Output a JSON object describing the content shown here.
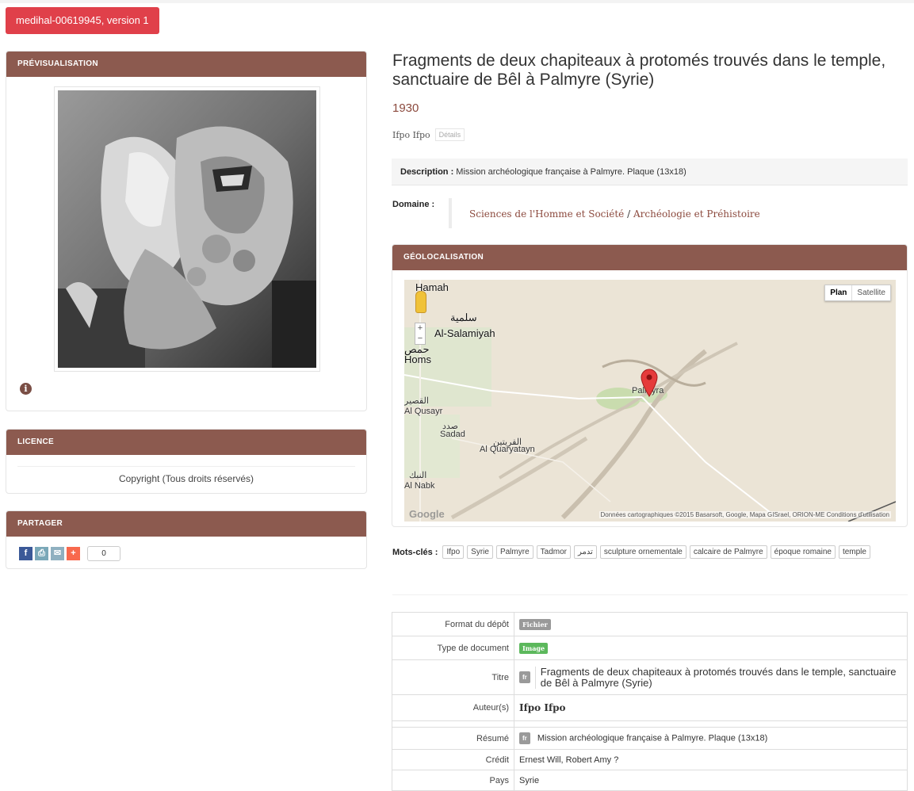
{
  "record": {
    "version_badge": "medihal-00619945, version 1",
    "title": "Fragments de deux chapiteaux à protomés trouvés dans le temple, sanctuaire de Bêl à Palmyre (Syrie)",
    "year": "1930",
    "author": "Ifpo Ifpo",
    "details_label": "Détails",
    "description_label": "Description :",
    "description_text": "Mission archéologique française à Palmyre. Plaque (13x18)",
    "domaine_label": "Domaine :",
    "domaine_parts": [
      "Sciences de l'Homme et Société",
      "/",
      "Archéologie et Préhistoire"
    ]
  },
  "sidebar": {
    "preview_header": "PRÉVISUALISATION",
    "licence_header": "LICENCE",
    "licence_text": "Copyright (Tous droits réservés)",
    "share_header": "PARTAGER",
    "share_count": "0",
    "share_icons": [
      "facebook-icon",
      "print-icon",
      "mail-icon",
      "addthis-icon"
    ]
  },
  "geo": {
    "header": "GÉOLOCALISATION",
    "btn_plan": "Plan",
    "btn_satellite": "Satellite",
    "zoom_in": "+",
    "zoom_out": "−",
    "labels": {
      "hamah": "Hamah",
      "salamiyah_ar": "سلمية",
      "salamiyah": "Al-Salamiyah",
      "homs_ar": "حمص",
      "homs": "Homs",
      "palmyra": "Palmyra",
      "qusayr_ar": "القصير",
      "qusayr": "Al Qusayr",
      "sadad_ar": "صدد",
      "sadad": "Sadad",
      "quaryatayn_ar": "القريتين",
      "quaryatayn": "Al Quaryatayn",
      "nabk_ar": "النبك",
      "nabk": "Al Nabk"
    },
    "logo": "Google",
    "copyright": "Données cartographiques ©2015 Basarsoft, Google, Mapa GISrael, ORION-ME   Conditions d'utilisation"
  },
  "keywords": {
    "label": "Mots-clés :",
    "items": [
      "Ifpo",
      "Syrie",
      "Palmyre",
      "Tadmor",
      "تدمر",
      "sculpture ornementale",
      "calcaire de Palmyre",
      "époque romaine",
      "temple"
    ]
  },
  "meta": {
    "format_key": "Format du dépôt",
    "format_val": "Fichier",
    "type_key": "Type de document",
    "type_val": "Image",
    "titre_key": "Titre",
    "titre_lang": "fr",
    "titre_val": "Fragments de deux chapiteaux à protomés trouvés dans le temple, sanctuaire de Bêl à Palmyre (Syrie)",
    "auteur_key": "Auteur(s)",
    "auteur_val": "Ifpo Ifpo",
    "resume_key": "Résumé",
    "resume_lang": "fr",
    "resume_val": "Mission archéologique française à Palmyre. Plaque (13x18)",
    "credit_key": "Crédit",
    "credit_val": "Ernest Will, Robert Amy ?",
    "pays_key": "Pays",
    "pays_val": "Syrie"
  },
  "colors": {
    "panel_header": "#8c5a4f",
    "badge_red": "#e0404a",
    "link_brown": "#8c4a3e",
    "tag_green": "#5cb85c"
  }
}
